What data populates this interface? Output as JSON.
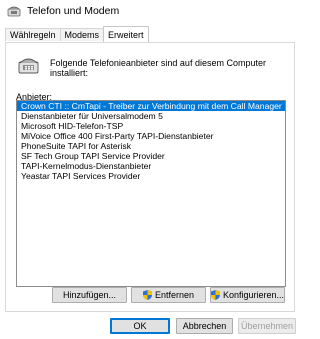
{
  "window": {
    "title": "Telefon und Modem"
  },
  "tabs": [
    {
      "label": "Wählregeln"
    },
    {
      "label": "Modems"
    },
    {
      "label": "Erweitert"
    }
  ],
  "panel": {
    "info_text": "Folgende Telefonieanbieter sind auf diesem Computer installiert:",
    "list_label": "Anbieter:",
    "items": [
      "Crown CTI :: CmTapi - Treiber zur Verbindung mit dem Call Manager",
      "Dienstanbieter für Universalmodem 5",
      "Microsoft HID-Telefon-TSP",
      "MiVoice Office 400 First-Party TAPI-Dienstanbieter",
      "PhoneSuite TAPI for Asterisk",
      "SF Tech Group TAPI Service Provider",
      "TAPI-Kernelmodus-Dienstanbieter",
      "Yeastar TAPI Services Provider"
    ],
    "selected_index": 0
  },
  "buttons": {
    "add": "Hinzufügen...",
    "remove": "Entfernen",
    "configure": "Konfigurieren...",
    "ok": "OK",
    "cancel": "Abbrechen",
    "apply": "Übernehmen"
  },
  "colors": {
    "selection": "#0078d7",
    "accent": "#0078d7"
  }
}
